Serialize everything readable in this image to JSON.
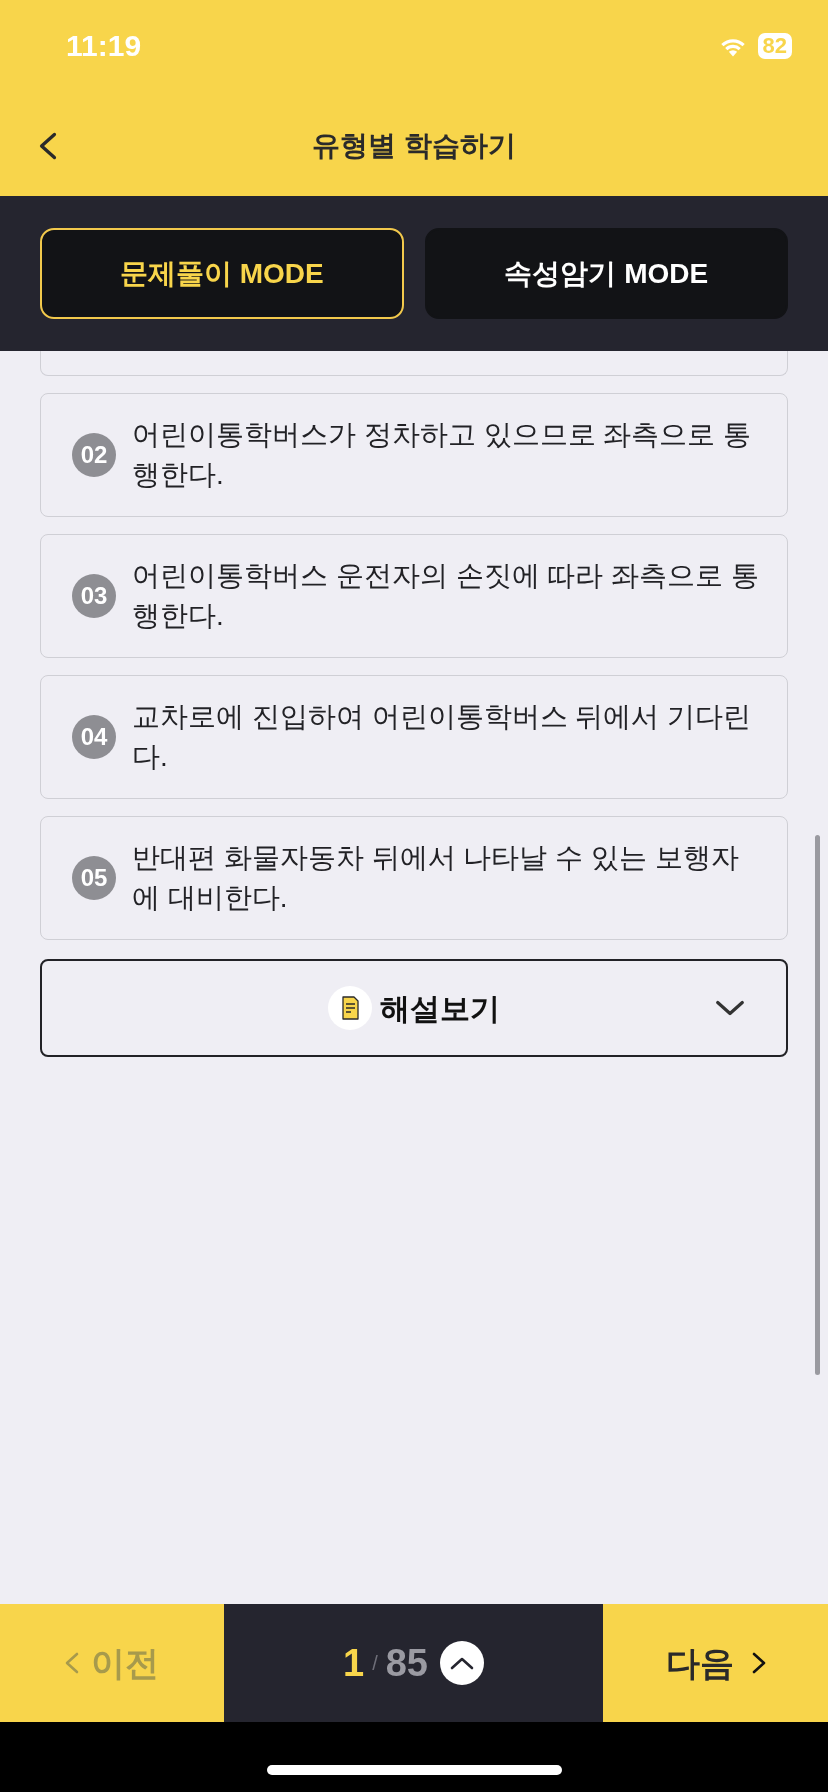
{
  "status_bar": {
    "time": "11:19",
    "battery": "82"
  },
  "header": {
    "title": "유형별 학습하기"
  },
  "modes": [
    {
      "label": "문제풀이 MODE",
      "selected": true
    },
    {
      "label": "속성암기 MODE",
      "selected": false
    }
  ],
  "options": [
    {
      "number": "02",
      "text": "어린이통학버스가 정차하고 있으므로 좌측으로 통행한다."
    },
    {
      "number": "03",
      "text": "어린이통학버스 운전자의 손짓에 따라 좌측으로 통행한다."
    },
    {
      "number": "04",
      "text": "교차로에 진입하여 어린이통학버스 뒤에서 기다린다."
    },
    {
      "number": "05",
      "text": "반대편 화물자동차 뒤에서 나타날 수 있는 보행자에 대비한다."
    }
  ],
  "explanation": {
    "label": "해설보기",
    "expanded": false
  },
  "pager": {
    "prev": {
      "label": "이전",
      "disabled": true
    },
    "current": "1",
    "separator": "/",
    "total": "85",
    "next": {
      "label": "다음",
      "disabled": false
    }
  }
}
